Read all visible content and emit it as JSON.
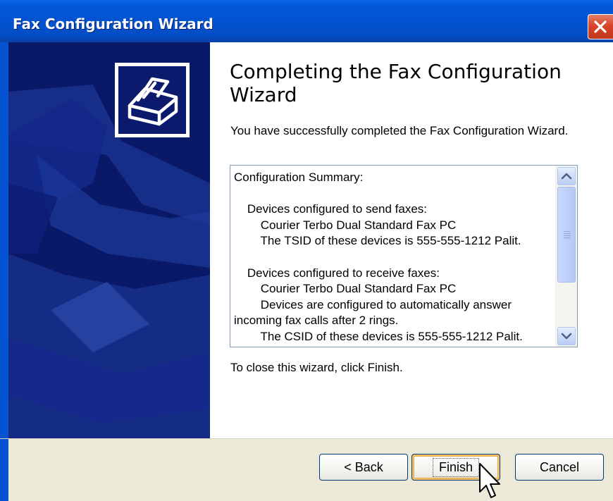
{
  "window": {
    "title": "Fax Configuration Wizard",
    "close_icon": "close-x-icon"
  },
  "side_panel": {
    "logo_icon": "fax-machine-icon",
    "colors": {
      "panel": "#0a1868",
      "art": "#1a3490"
    }
  },
  "content": {
    "heading": "Completing the Fax Configuration Wizard",
    "intro": "You have successfully completed the Fax Configuration Wizard.",
    "summary": {
      "lines": [
        "Configuration Summary:",
        "",
        "    Devices configured to send faxes:",
        "        Courier Terbo Dual Standard Fax PC",
        "        The TSID of these devices is 555-555-1212 Palit.",
        "",
        "    Devices configured to receive faxes:",
        "        Courier Terbo Dual Standard Fax PC",
        "        Devices are configured to automatically answer",
        "incoming fax calls after 2 rings.",
        "        The CSID of these devices is 555-555-1212 Palit."
      ],
      "scroll_up_icon": "scroll-up-arrow-icon",
      "scroll_down_icon": "scroll-down-arrow-icon"
    },
    "outro": "To close this wizard, click Finish."
  },
  "buttons": {
    "back": "< Back",
    "finish": "Finish",
    "cancel": "Cancel",
    "focused": "finish"
  },
  "colors": {
    "titlebar": "#0353d0",
    "close": "#d8452a",
    "bottom_bar": "#ece9d8",
    "button_border": "#003c74",
    "focus_ring": "#f3c26a"
  },
  "cursor_icon": "mouse-pointer-icon"
}
